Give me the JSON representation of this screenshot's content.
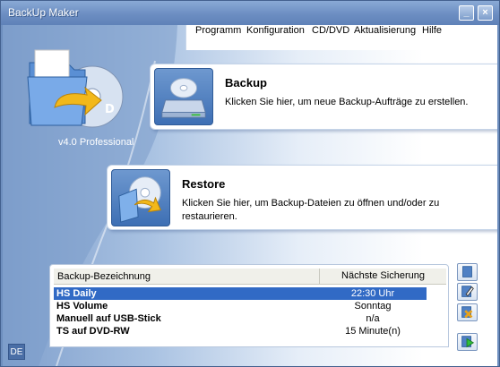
{
  "window": {
    "title": "BackUp Maker",
    "minimize_glyph": "_",
    "close_glyph": "×"
  },
  "app": {
    "version": "v4.0 Professional",
    "logo_icon": "cd-folder-logo-icon"
  },
  "menu": {
    "items": [
      "Programm",
      "Konfiguration",
      "CD/DVD",
      "Aktualisierung",
      "Hilfe"
    ]
  },
  "backup": {
    "title": "Backup",
    "description": "Klicken Sie hier, um neue Backup-Aufträge zu erstellen.",
    "icon": "backup-drive-icon"
  },
  "restore": {
    "title": "Restore",
    "description": "Klicken Sie hier, um Backup-Dateien zu öffnen und/oder zu restaurieren.",
    "icon": "restore-cd-icon"
  },
  "jobs": {
    "columns": [
      "Backup-Bezeichnung",
      "Nächste Sicherung"
    ],
    "rows": [
      {
        "name": "HS Daily",
        "next": "22:30 Uhr",
        "selected": true
      },
      {
        "name": "HS Volume",
        "next": "Sonntag",
        "selected": false
      },
      {
        "name": "Manuell auf USB-Stick",
        "next": "n/a",
        "selected": false
      },
      {
        "name": "TS auf DVD-RW",
        "next": "15 Minute(n)",
        "selected": false
      }
    ]
  },
  "side_buttons": [
    "new-job-icon",
    "edit-job-icon",
    "delete-job-icon",
    "run-job-icon"
  ],
  "language": "DE",
  "colors": {
    "selection": "#316ac5",
    "titlebar": "#6c8ec2"
  }
}
